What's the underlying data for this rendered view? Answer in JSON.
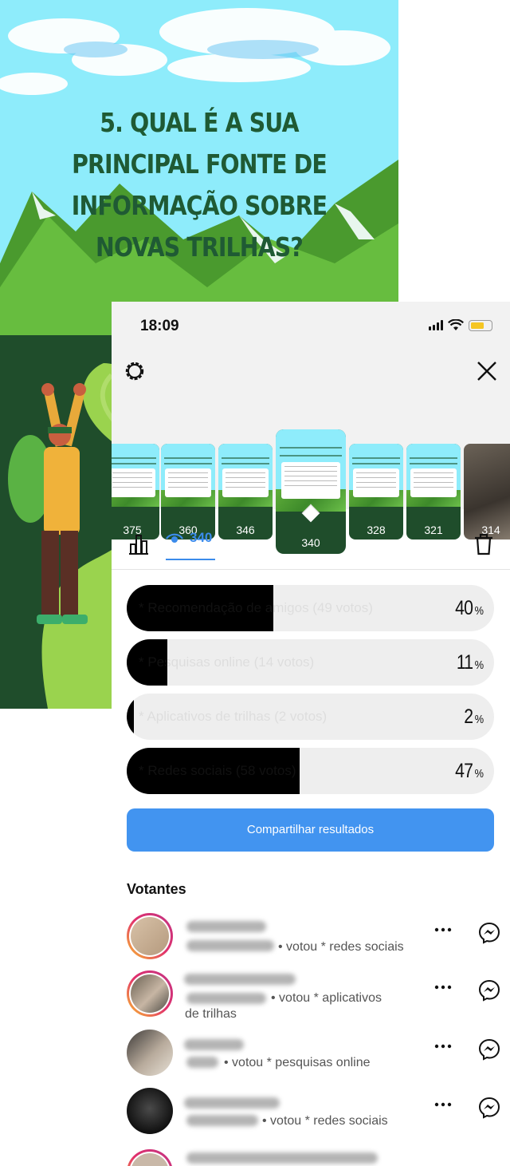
{
  "poster": {
    "question": "5. QUAL É A SUA PRINCIPAL FONTE DE INFORMAÇÃO SOBRE NOVAS TRILHAS?",
    "colors": {
      "sky": "#8eecfb",
      "mountain": "#5fae3a",
      "title": "#1f5a34"
    }
  },
  "status_bar": {
    "time": "18:09"
  },
  "header": {
    "settings_icon": "gear-icon",
    "close_icon": "close-icon",
    "thumbnails": [
      {
        "count": "375",
        "active": false
      },
      {
        "count": "360",
        "active": false
      },
      {
        "count": "346",
        "active": false
      },
      {
        "count": "340",
        "active": true
      },
      {
        "count": "328",
        "active": false
      },
      {
        "count": "321",
        "active": false
      },
      {
        "count": "314",
        "active": false
      }
    ]
  },
  "tabs": {
    "views_count": "340"
  },
  "poll": {
    "options": [
      {
        "label": "* Recomendação de amigos (49 votos)",
        "percent": 40,
        "percent_text": "40"
      },
      {
        "label": "* Pesquisas online (14 votos)",
        "percent": 11,
        "percent_text": "11"
      },
      {
        "label": "* Aplicativos de trilhas (2 votos)",
        "percent": 2,
        "percent_text": "2"
      },
      {
        "label": "* Redes sociais (58 votos)",
        "percent": 47,
        "percent_text": "47"
      }
    ],
    "percent_sign": "%",
    "share_label": "Compartilhar resultados",
    "colors": {
      "fill": "#000000",
      "track": "#eeeeee",
      "button": "#4294f0"
    }
  },
  "voters": {
    "title": "Votantes",
    "items": [
      {
        "vote_line1": "• votou * redes sociais",
        "vote_line2": ""
      },
      {
        "vote_line1": "• votou * aplicativos",
        "vote_line2": "de trilhas"
      },
      {
        "vote_line1": "• votou * pesquisas online",
        "vote_line2": ""
      },
      {
        "vote_line1": "• votou * redes sociais",
        "vote_line2": ""
      },
      {
        "vote_line1": "",
        "vote_line2": ""
      }
    ]
  }
}
